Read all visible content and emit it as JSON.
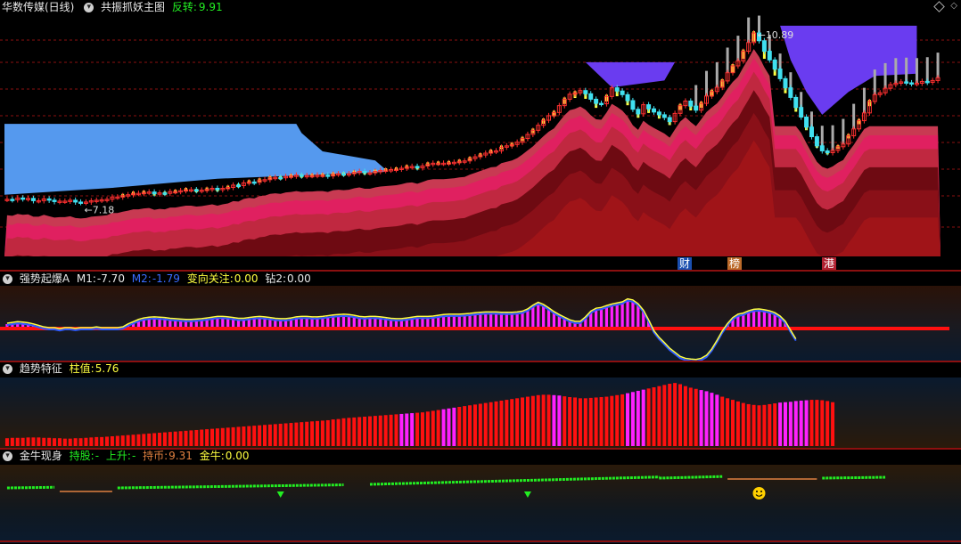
{
  "main": {
    "stock": "华数传媒(日线)",
    "indicator": "共振抓妖主图",
    "reversal_label": "反转:",
    "reversal_value": "9.91",
    "high_label": "10.89",
    "low_label": "7.18",
    "events": [
      "财",
      "榜",
      "港"
    ]
  },
  "pane2": {
    "name": "强势起爆A",
    "m1_label": "M1:",
    "m1_value": "-7.70",
    "m2_label": "M2:",
    "m2_value": "-1.79",
    "turn_label": "变向关注:",
    "turn_value": "0.00",
    "zuan_label": "钻2:",
    "zuan_value": "0.00"
  },
  "pane3": {
    "name": "趋势特征",
    "bar_label": "柱值:",
    "bar_value": "5.76"
  },
  "pane4": {
    "name": "金牛现身",
    "hold_label": "持股:",
    "hold_value": "-",
    "up_label": "上升:",
    "up_value": "-",
    "coin_label": "持币:",
    "coin_value": "9.31",
    "bull_label": "金牛:",
    "bull_value": "0.00"
  },
  "colors": {
    "bg": "#000000",
    "grid": "#8b1010",
    "up": "#ff3030",
    "down": "#40e0f0",
    "magenta": "#ff20ff",
    "red": "#ff1010",
    "yellow": "#ffff40",
    "green": "#22ee22",
    "orange": "#e08040",
    "cloud_blue": "#5599ee",
    "cloud_purple": "#6a3cf0"
  },
  "chart_data": [
    {
      "type": "line",
      "title": "华数传媒(日线) 共振抓妖主图",
      "x": [
        1,
        2,
        3,
        4,
        5,
        6,
        7,
        8,
        9,
        10,
        11,
        12,
        13,
        14,
        15,
        16,
        17,
        18,
        19,
        20,
        21,
        22,
        23,
        24,
        25,
        26,
        27,
        28,
        29,
        30,
        31,
        32,
        33,
        34,
        35,
        36,
        37,
        38,
        39,
        40,
        41,
        42,
        43,
        44,
        45,
        46,
        47,
        48,
        49,
        50,
        51,
        52,
        53,
        54,
        55,
        56,
        57,
        58,
        59,
        60,
        61,
        62,
        63,
        64,
        65,
        66,
        67,
        68,
        69,
        70,
        71,
        72,
        73,
        74,
        75,
        76,
        77,
        78,
        79,
        80,
        81,
        82,
        83,
        84,
        85,
        86,
        87,
        88,
        89,
        90,
        91,
        92,
        93,
        94,
        95,
        96,
        97,
        98,
        99,
        100,
        101,
        102,
        103,
        104,
        105,
        106,
        107,
        108,
        109,
        110,
        111,
        112,
        113,
        114,
        115,
        116,
        117,
        118,
        119,
        120,
        121,
        122,
        123,
        124,
        125,
        126,
        127,
        128,
        129,
        130,
        131,
        132,
        133,
        134,
        135,
        136,
        137,
        138,
        139,
        140,
        141,
        142,
        143,
        144,
        145,
        146,
        147,
        148,
        149,
        150,
        151,
        152,
        153,
        154,
        155,
        156,
        157,
        158,
        159,
        160,
        161,
        162,
        163,
        164,
        165,
        166,
        167,
        168,
        169,
        170,
        171,
        172,
        173,
        174
      ],
      "series": [
        {
          "values": [
            7.25,
            7.24,
            7.28,
            7.26,
            7.27,
            7.22,
            7.22,
            7.26,
            7.23,
            7.2,
            7.21,
            7.21,
            7.23,
            7.19,
            7.18,
            7.19,
            7.22,
            7.23,
            7.24,
            7.25,
            7.3,
            7.3,
            7.33,
            7.35,
            7.38,
            7.38,
            7.4,
            7.41,
            7.37,
            7.39,
            7.38,
            7.42,
            7.42,
            7.44,
            7.46,
            7.46,
            7.44,
            7.45,
            7.47,
            7.49,
            7.46,
            7.49,
            7.51,
            7.56,
            7.55,
            7.61,
            7.63,
            7.62,
            7.67,
            7.68,
            7.72,
            7.73,
            7.72,
            7.75,
            7.76,
            7.78,
            7.76,
            7.77,
            7.77,
            7.78,
            7.78,
            7.76,
            7.8,
            7.81,
            7.8,
            7.81,
            7.84,
            7.86,
            7.83,
            7.83,
            7.86,
            7.88,
            7.89,
            7.9,
            7.91,
            7.93,
            7.96,
            7.97,
            7.94,
            7.98,
            8.02,
            8.04,
            8.04,
            8.04,
            8.05,
            8.06,
            8.08,
            8.09,
            8.14,
            8.18,
            8.22,
            8.26,
            8.3,
            8.31,
            8.39,
            8.42,
            8.45,
            8.5,
            8.58,
            8.67,
            8.76,
            8.87,
            8.98,
            9.08,
            9.15,
            9.3,
            9.44,
            9.55,
            9.58,
            9.63,
            9.56,
            9.44,
            9.35,
            9.34,
            9.5,
            9.69,
            9.62,
            9.54,
            9.41,
            9.22,
            9.12,
            9.32,
            9.23,
            9.16,
            9.1,
            9.04,
            8.95,
            9.13,
            9.3,
            9.4,
            9.29,
            9.2,
            9.35,
            9.51,
            9.61,
            9.7,
            9.84,
            10.02,
            10.17,
            10.28,
            10.49,
            10.68,
            10.89,
            10.72,
            10.49,
            10.3,
            10.1,
            9.89,
            9.69,
            9.48,
            9.26,
            9.05,
            8.83,
            8.62,
            8.42,
            8.31,
            8.27,
            8.32,
            8.4,
            8.46,
            8.64,
            8.79,
            8.97,
            9.14,
            9.39,
            9.54,
            9.58,
            9.68,
            9.76,
            9.79,
            9.82,
            9.8,
            9.78,
            9.79,
            9.83,
            9.81,
            9.85,
            9.91
          ]
        }
      ],
      "high_label": 10.89,
      "low_label": 7.18
    },
    {
      "type": "bar",
      "title": "强势起爆A",
      "x": [
        1,
        2,
        3,
        4,
        5,
        6,
        7,
        8,
        9,
        10,
        11,
        12,
        13,
        14,
        15,
        16,
        17,
        18,
        19,
        20,
        21,
        22,
        23,
        24,
        25,
        26,
        27,
        28,
        29,
        30,
        31,
        32,
        33,
        34,
        35,
        36,
        37,
        38,
        39,
        40,
        41,
        42,
        43,
        44,
        45,
        46,
        47,
        48,
        49,
        50,
        51,
        52,
        53,
        54,
        55,
        56,
        57,
        58,
        59,
        60,
        61,
        62,
        63,
        64,
        65,
        66,
        67,
        68,
        69,
        70,
        71,
        72,
        73,
        74,
        75,
        76,
        77,
        78,
        79,
        80,
        81,
        82,
        83,
        84,
        85,
        86,
        87,
        88,
        89,
        90,
        91,
        92,
        93,
        94,
        95,
        96,
        97,
        98,
        99,
        100,
        101,
        102,
        103,
        104,
        105,
        106,
        107,
        108,
        109,
        110,
        111,
        112,
        113,
        114,
        115,
        116,
        117,
        118,
        119,
        120,
        121,
        122,
        123,
        124,
        125,
        126,
        127,
        128,
        129,
        130,
        131,
        132,
        133,
        134,
        135,
        136,
        137,
        138,
        139,
        140,
        141,
        142,
        143,
        144,
        145,
        146,
        147,
        148,
        149,
        150,
        151,
        152,
        153,
        154,
        155,
        156,
        157,
        158,
        159,
        160,
        161,
        162,
        163,
        164,
        165,
        166,
        167,
        168,
        169,
        170,
        171,
        172,
        173,
        174
      ],
      "series": [
        {
          "name": "M1",
          "values": [
            1.2,
            1.4,
            1.6,
            1.5,
            1.3,
            1.0,
            0.6,
            0.2,
            0.0,
            0.0,
            -0.3,
            0.0,
            0.0,
            -0.2,
            0.0,
            0.0,
            0.0,
            0.2,
            0.0,
            0.0,
            0.0,
            0.0,
            0.2,
            1.0,
            1.6,
            2.2,
            2.6,
            2.8,
            2.9,
            2.8,
            2.7,
            2.5,
            2.4,
            2.3,
            2.2,
            2.2,
            2.3,
            2.4,
            2.6,
            2.8,
            3.0,
            3.0,
            2.9,
            2.7,
            2.5,
            2.5,
            2.7,
            2.9,
            3.0,
            2.9,
            2.7,
            2.5,
            2.4,
            2.4,
            2.6,
            2.9,
            3.0,
            3.0,
            2.9,
            2.9,
            3.0,
            3.2,
            3.4,
            3.5,
            3.6,
            3.5,
            3.3,
            3.0,
            2.9,
            3.0,
            3.0,
            2.9,
            2.7,
            2.5,
            2.4,
            2.4,
            2.6,
            2.8,
            3.0,
            3.0,
            3.0,
            3.1,
            3.3,
            3.5,
            3.6,
            3.6,
            3.6,
            3.7,
            3.8,
            4.0,
            4.1,
            4.2,
            4.2,
            4.2,
            4.1,
            4.1,
            4.1,
            4.2,
            4.4,
            5.0,
            6.0,
            6.8,
            6.2,
            5.3,
            4.3,
            3.5,
            2.8,
            2.1,
            1.7,
            1.7,
            2.9,
            4.4,
            5.2,
            5.4,
            5.9,
            6.3,
            6.6,
            6.9,
            7.7,
            7.4,
            6.4,
            4.7,
            2.1,
            -0.8,
            -2.6,
            -4.0,
            -5.5,
            -6.6,
            -7.7,
            -8.2,
            -8.4,
            -8.5,
            -8.2,
            -7.4,
            -5.7,
            -3.4,
            -0.9,
            1.1,
            2.7,
            3.6,
            3.9,
            4.5,
            4.9,
            5.0,
            4.8,
            4.5,
            4.0,
            3.1,
            1.7,
            -0.7,
            -3.0
          ],
          "colored_bars": "magenta positive columns above zero line"
        },
        {
          "name": "M2",
          "values": []
        }
      ],
      "latest": {
        "M1": -7.7,
        "M2": -1.79,
        "变向关注": 0.0,
        "钻2": 0.0
      }
    },
    {
      "type": "bar",
      "title": "趋势特征",
      "categories": [],
      "values": [
        2.0,
        2.1,
        2.1,
        2.1,
        2.2,
        2.2,
        2.2,
        2.1,
        2.1,
        2.0,
        2.0,
        1.9,
        1.9,
        2.0,
        2.0,
        2.1,
        2.2,
        2.3,
        2.3,
        2.4,
        2.5,
        2.6,
        2.7,
        2.8,
        2.9,
        3.0,
        3.1,
        3.2,
        3.3,
        3.4,
        3.5,
        3.6,
        3.7,
        3.8,
        3.9,
        4.0,
        4.1,
        4.2,
        4.3,
        4.4,
        4.5,
        4.6,
        4.7,
        4.8,
        4.9,
        5.0,
        5.1,
        5.2,
        5.3,
        5.4,
        5.5,
        5.6,
        5.7,
        5.8,
        5.9,
        6.0,
        6.1,
        6.2,
        6.3,
        6.4,
        6.5,
        6.6,
        6.8,
        6.9,
        7.1,
        7.2,
        7.3,
        7.4,
        7.5,
        7.6,
        7.7,
        7.8,
        7.9,
        8.0,
        8.1,
        8.2,
        8.3,
        8.4,
        8.5,
        8.6,
        8.8,
        9.0,
        9.2,
        9.4,
        9.6,
        9.8,
        10.0,
        10.2,
        10.4,
        10.6,
        10.8,
        11.0,
        11.2,
        11.4,
        11.6,
        11.8,
        12.0,
        12.2,
        12.4,
        12.6,
        12.8,
        13.0,
        13.1,
        13.1,
        13.0,
        12.9,
        12.7,
        12.5,
        12.4,
        12.2,
        12.2,
        12.3,
        12.4,
        12.5,
        12.6,
        12.8,
        13.0,
        13.2,
        13.5,
        13.8,
        14.1,
        14.4,
        14.7,
        15.0,
        15.3,
        15.6,
        15.9,
        16.1,
        15.8,
        15.3,
        14.9,
        14.6,
        14.3,
        14.0,
        13.6,
        13.1,
        12.6,
        12.2,
        11.8,
        11.4,
        11.0,
        10.7,
        10.5,
        10.4,
        10.5,
        10.7,
        10.9,
        11.1,
        11.2,
        11.3,
        11.5,
        11.6,
        11.7,
        11.8,
        11.8,
        11.7,
        11.5,
        11.2
      ],
      "highlight": "magenta bars mark trend feature",
      "latest": 5.76
    },
    {
      "type": "line",
      "title": "金牛现身",
      "latest": {
        "持股": "-",
        "上升": "-",
        "持币": 9.31,
        "金牛": 0.0
      }
    }
  ]
}
